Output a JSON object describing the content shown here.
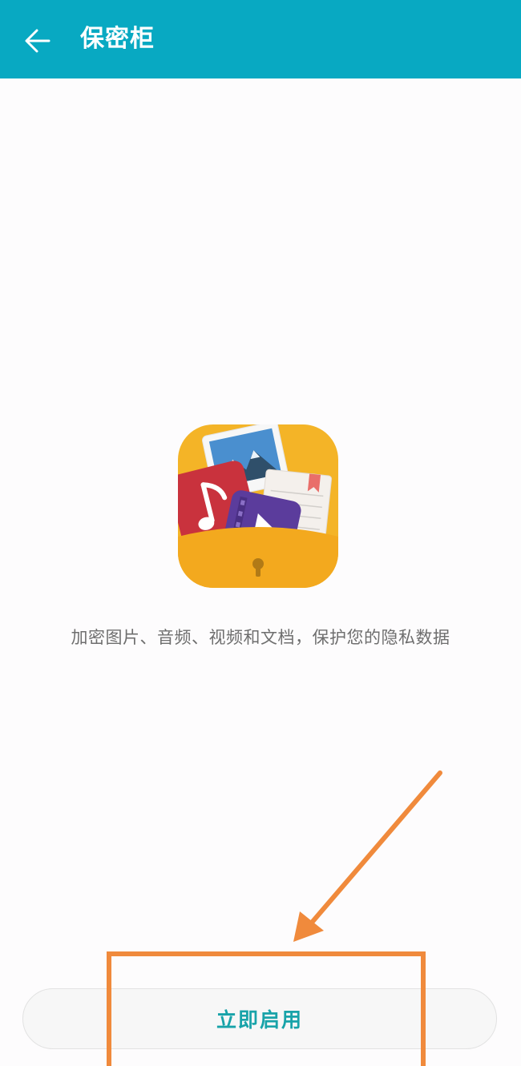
{
  "header": {
    "title": "保密柜",
    "back_icon": "arrow-left-icon"
  },
  "hero": {
    "icon": "vault-folder-icon"
  },
  "description": "加密图片、音频、视频和文档，保护您的隐私数据",
  "primary_button": {
    "label": "立即启用"
  },
  "colors": {
    "app_bar": "#08a9c2",
    "button_text": "#18a3a9",
    "annotation": "#f08a3c",
    "folder": "#f4b427"
  }
}
